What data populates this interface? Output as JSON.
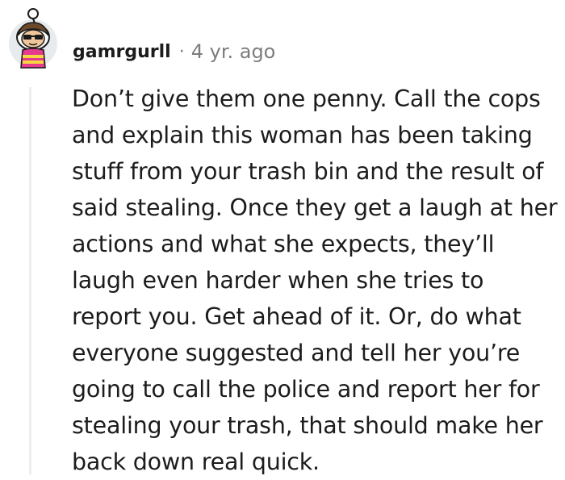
{
  "comment": {
    "username": "gamrgurll",
    "separator": "·",
    "timestamp": "4 yr. ago",
    "body": "Don’t give them one penny. Call the cops and explain this woman has been taking stuff from your trash bin and the result of said stealing. Once they get a laugh at her actions and what she expects, they’ll laugh even harder when she tries to report you. Get ahead of it. Or, do what everyone suggested and tell her you’re going to call the police and report her for stealing your trash, that should make her back down real quick."
  },
  "avatar": {
    "icon": "snoo-avatar-icon",
    "colors": {
      "skin": "#f0c79a",
      "sunglasses": "#1a1a1a",
      "hair": "#6b4a2b",
      "shirt": "#e53b8f",
      "stripe": "#f5d742",
      "background": "#e8ebee"
    }
  },
  "colors": {
    "text": "#1c1c1c",
    "muted": "#7c7c7c",
    "thread_line": "#eceef0"
  }
}
